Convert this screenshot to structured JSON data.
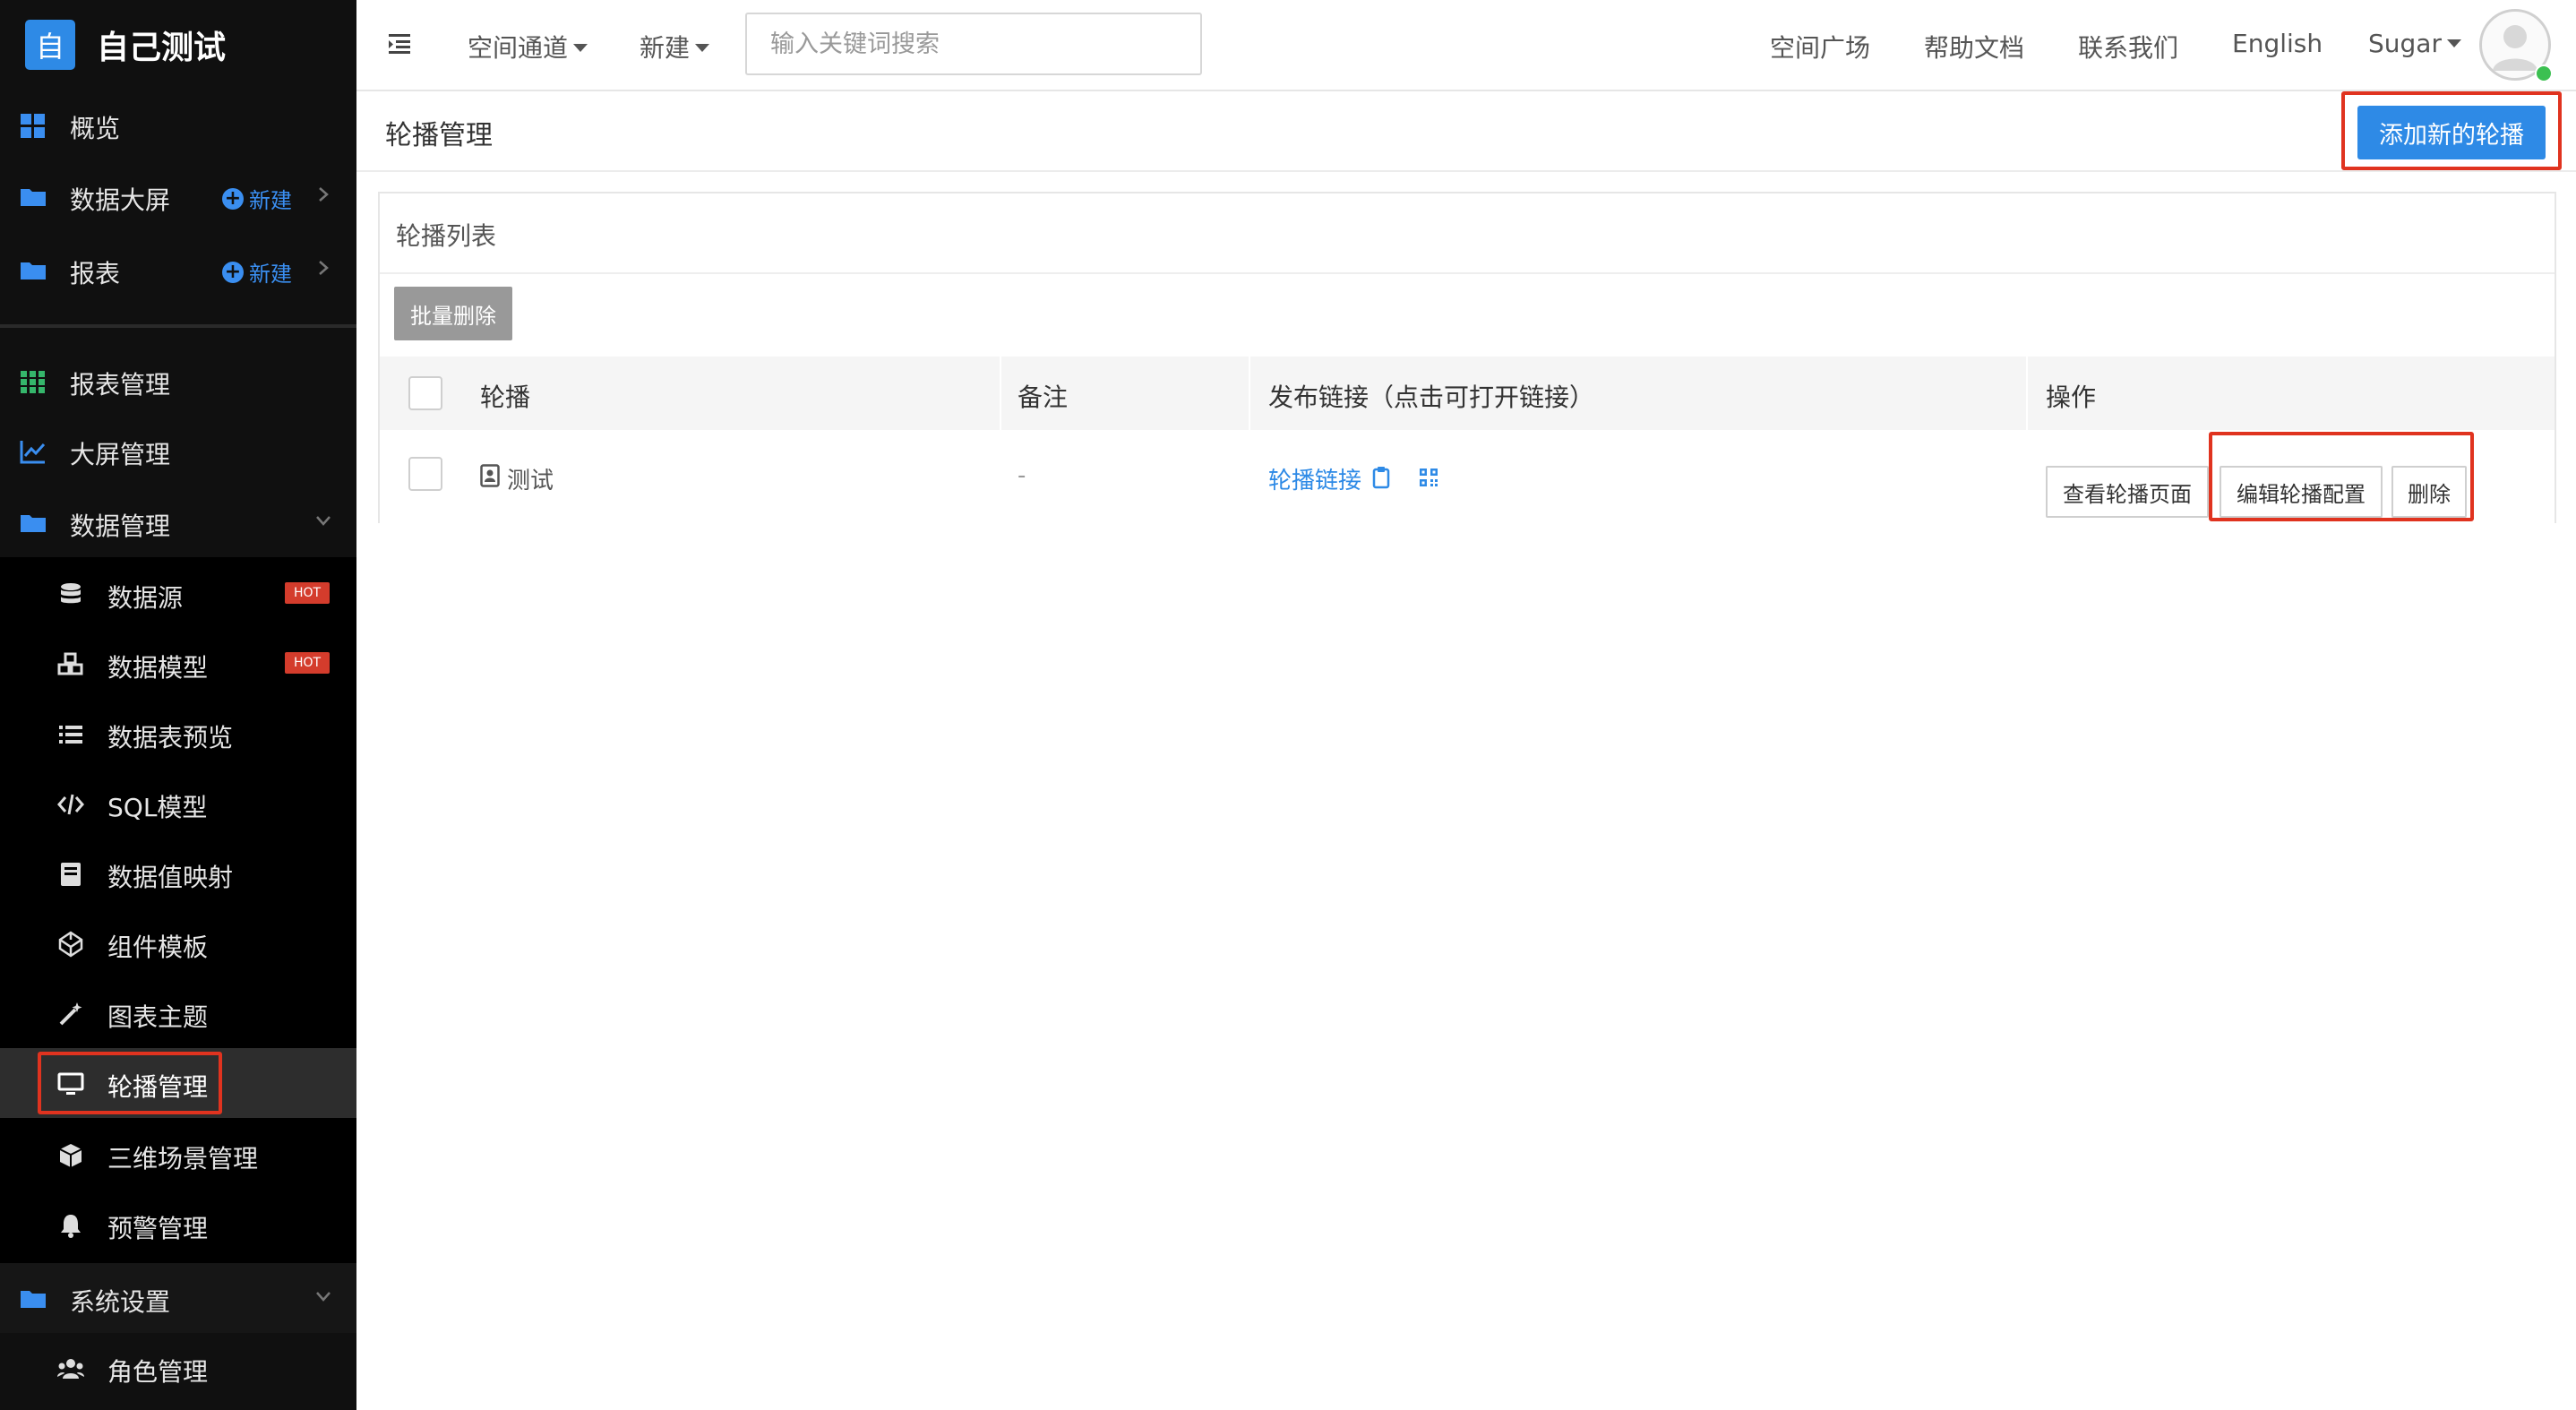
{
  "app": {
    "logo_char": "自",
    "title": "自己测试"
  },
  "sidebar": {
    "top_items": [
      {
        "label": "概览",
        "icon": "dashboard-grid-icon"
      },
      {
        "label": "数据大屏",
        "icon": "folder-icon",
        "new_label": "新建"
      },
      {
        "label": "报表",
        "icon": "folder-icon",
        "new_label": "新建"
      }
    ],
    "items": [
      {
        "label": "报表管理",
        "icon": "table-grid-icon"
      },
      {
        "label": "大屏管理",
        "icon": "line-chart-icon"
      },
      {
        "label": "数据管理",
        "icon": "folder-icon"
      },
      {
        "label": "数据源",
        "icon": "database-icon",
        "badge": "HOT"
      },
      {
        "label": "数据模型",
        "icon": "cubes-icon",
        "badge": "HOT"
      },
      {
        "label": "数据表预览",
        "icon": "list-icon"
      },
      {
        "label": "SQL模型",
        "icon": "code-icon"
      },
      {
        "label": "数据值映射",
        "icon": "book-icon"
      },
      {
        "label": "组件模板",
        "icon": "codepen-icon"
      },
      {
        "label": "图表主题",
        "icon": "magic-wand-icon"
      },
      {
        "label": "轮播管理",
        "icon": "monitor-icon"
      },
      {
        "label": "三维场景管理",
        "icon": "cube-icon"
      },
      {
        "label": "预警管理",
        "icon": "bell-icon"
      },
      {
        "label": "系统设置",
        "icon": "folder-icon"
      },
      {
        "label": "角色管理",
        "icon": "users-icon"
      }
    ]
  },
  "topbar": {
    "space_channel": "空间通道",
    "new": "新建",
    "search_placeholder": "输入关键词搜索",
    "links": [
      "空间广场",
      "帮助文档",
      "联系我们",
      "English"
    ],
    "user": "Sugar"
  },
  "page": {
    "title": "轮播管理",
    "add_button": "添加新的轮播",
    "panel_title": "轮播列表",
    "batch_delete": "批量删除",
    "table": {
      "headers": [
        "轮播",
        "备注",
        "发布链接（点击可打开链接）",
        "操作"
      ],
      "rows": [
        {
          "name": "测试",
          "note": "-",
          "link": "轮播链接",
          "actions": [
            "查看轮播页面",
            "编辑轮播配置",
            "删除"
          ]
        }
      ]
    }
  },
  "colors": {
    "accent": "#2e8ae6",
    "highlight": "#e0331f",
    "sidebar_bg": "#101010",
    "hot": "#d43c2c"
  }
}
